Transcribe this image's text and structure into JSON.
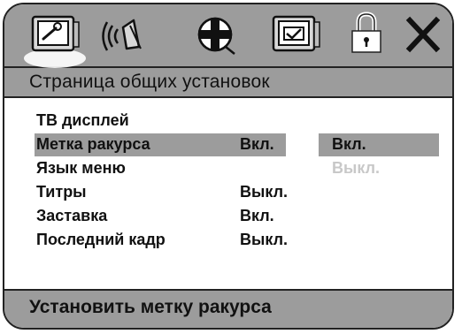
{
  "colors": {
    "bar_gray": "#9c9c9c",
    "highlight_gray": "#9c9c9c",
    "panel_white": "#ffffff",
    "border": "#222222",
    "text": "#111111",
    "disabled_text": "#c8c8c8"
  },
  "icon_bar": {
    "tabs": [
      {
        "icon": "general-setup-tv-wrench-icon",
        "selected": true
      },
      {
        "icon": "audio-speaker-icon",
        "selected": false
      },
      {
        "icon": "video-film-reel-icon",
        "selected": false
      },
      {
        "icon": "preferences-checkbox-icon",
        "selected": false
      },
      {
        "icon": "password-lock-icon",
        "selected": false
      },
      {
        "icon": "exit-close-icon",
        "selected": false
      }
    ]
  },
  "title": "Страница общих установок",
  "menu": {
    "items": [
      {
        "label": "ТВ дисплей",
        "value": ""
      },
      {
        "label": "Метка ракурса",
        "value": "Вкл."
      },
      {
        "label": "Язык меню",
        "value": ""
      },
      {
        "label": "Титры",
        "value": "Выкл."
      },
      {
        "label": "Заставка",
        "value": "Вкл."
      },
      {
        "label": "Последний кадр",
        "value": "Выкл."
      }
    ],
    "selected_item": "Метка ракурса"
  },
  "options": {
    "items": [
      {
        "label": "Вкл.",
        "state": "highlighted"
      },
      {
        "label": "Выкл.",
        "state": "dimmed"
      }
    ]
  },
  "status": "Установить метку ракурса"
}
